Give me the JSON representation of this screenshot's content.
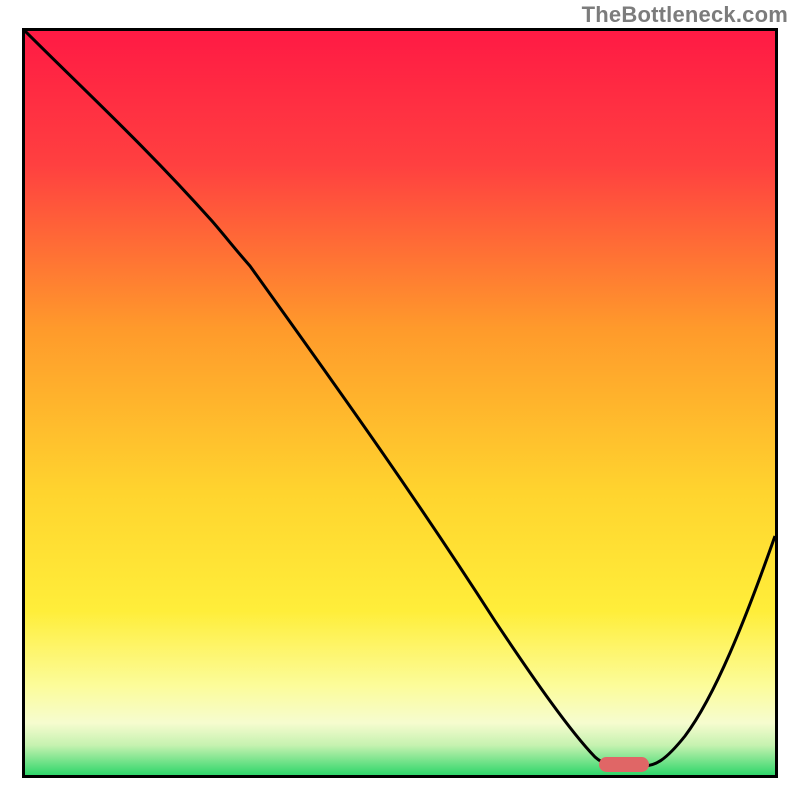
{
  "watermark": "TheBottleneck.com",
  "colors": {
    "gradient_red": "#ff1a44",
    "gradient_orange": "#ff8a2b",
    "gradient_yellow": "#ffe92e",
    "gradient_lightyellow": "#fcfca0",
    "gradient_green": "#2fd66a",
    "frame": "#000000",
    "curve": "#000000",
    "marker": "#e06666"
  },
  "chart_data": {
    "type": "line",
    "title": "",
    "xlabel": "",
    "ylabel": "",
    "xlim": [
      0,
      100
    ],
    "ylim": [
      0,
      100
    ],
    "series": [
      {
        "name": "bottleneck-curve",
        "x": [
          0,
          10,
          20,
          25,
          35,
          45,
          55,
          65,
          73,
          77,
          80,
          82,
          90,
          100
        ],
        "y": [
          100,
          90,
          80,
          74,
          60,
          46,
          32,
          18,
          6,
          2,
          2,
          2,
          12,
          32
        ]
      }
    ],
    "annotations": [
      {
        "name": "marker",
        "x_range": [
          76,
          82
        ],
        "y": 2
      }
    ],
    "legend": false,
    "grid": false
  }
}
